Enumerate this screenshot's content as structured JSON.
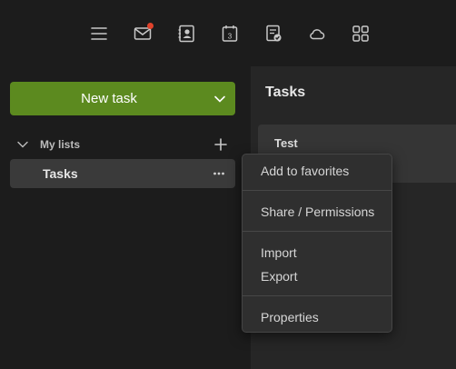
{
  "toolbar": {
    "icons": [
      {
        "name": "menu-icon"
      },
      {
        "name": "mail-icon",
        "has_notification": true
      },
      {
        "name": "contacts-icon"
      },
      {
        "name": "calendar-icon",
        "day": "3"
      },
      {
        "name": "tasks-icon"
      },
      {
        "name": "cloud-icon"
      },
      {
        "name": "apps-grid-icon"
      }
    ],
    "notification_color": "#e0422b"
  },
  "sidebar": {
    "new_task_label": "New task",
    "section_title": "My lists",
    "lists": [
      {
        "label": "Tasks",
        "selected": true
      }
    ]
  },
  "main": {
    "title": "Tasks",
    "tasks": [
      {
        "title": "Test"
      }
    ]
  },
  "context_menu": {
    "items": [
      {
        "label": "Add to favorites"
      },
      {
        "label": "Share / Permissions"
      },
      {
        "label": "Import"
      },
      {
        "label": "Export"
      },
      {
        "label": "Properties"
      }
    ]
  },
  "colors": {
    "accent": "#5c8a1f",
    "background": "#1c1c1c",
    "panel": "#262626",
    "menu": "#2f2f2f"
  }
}
